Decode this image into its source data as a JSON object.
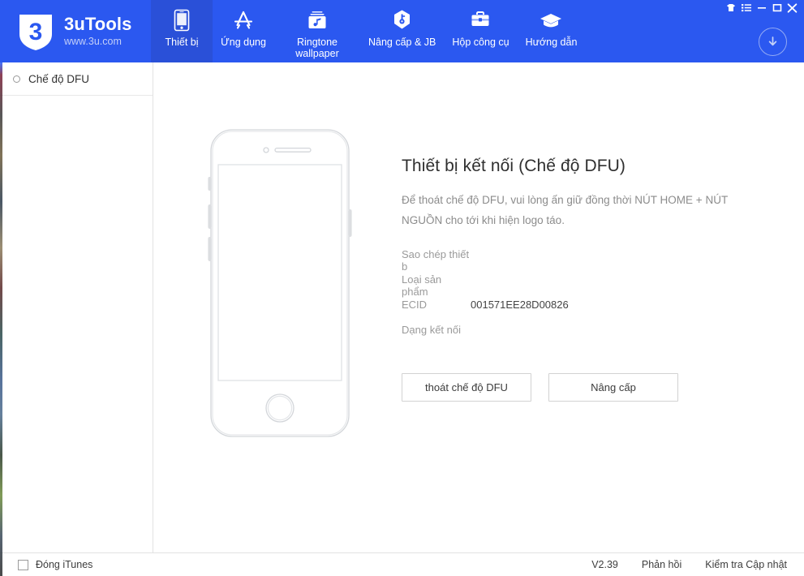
{
  "header": {
    "logo": {
      "mark": "shield-3-logo",
      "title": "3uTools",
      "subtitle": "www.3u.com"
    },
    "nav": [
      {
        "label": "Thiết bị",
        "icon": "phone-icon",
        "active": true
      },
      {
        "label": "Ứng dụng",
        "icon": "appstore-icon",
        "active": false
      },
      {
        "label": "Ringtone wallpaper",
        "icon": "ringtone-wallpaper-icon",
        "active": false
      },
      {
        "label": "Nâng cấp & JB",
        "icon": "shield-key-icon",
        "active": false
      },
      {
        "label": "Hộp công cụ",
        "icon": "toolbox-icon",
        "active": false
      },
      {
        "label": "Hướng dẫn",
        "icon": "graduation-cap-icon",
        "active": false
      }
    ],
    "window_buttons": [
      {
        "name": "skin-icon",
        "title": "Skin"
      },
      {
        "name": "menu-icon",
        "title": "Menu"
      },
      {
        "name": "minimize-icon",
        "title": "Minimize"
      },
      {
        "name": "maximize-icon",
        "title": "Maximize"
      },
      {
        "name": "close-icon",
        "title": "Close"
      }
    ],
    "download_button": {
      "name": "download-icon",
      "title": "Downloads"
    }
  },
  "sidebar": {
    "items": [
      {
        "label": "Chế độ DFU",
        "selected": true
      }
    ]
  },
  "main": {
    "device_illustration": "iphone-outline",
    "title": "Thiết bị kết nối (Chế độ DFU)",
    "description": "Để thoát chế độ DFU, vui lòng ấn giữ đồng thời NÚT HOME + NÚT NGUỒN cho tới khi hiện logo táo.",
    "rows": [
      {
        "key": "Sao chép thiết b",
        "value": ""
      },
      {
        "key": "Loại sản phẩm",
        "value": ""
      },
      {
        "key": "ECID",
        "value": "001571EE28D00826"
      },
      {
        "key": "Dạng kết nối",
        "value": ""
      }
    ],
    "buttons": [
      {
        "label": "thoát chế độ DFU"
      },
      {
        "label": "Nâng cấp"
      }
    ]
  },
  "statusbar": {
    "close_itunes_label": "Đóng iTunes",
    "close_itunes_checked": false,
    "version": "V2.39",
    "feedback_label": "Phản hồi",
    "check_update_label": "Kiểm tra Cập nhật"
  },
  "colors": {
    "brand_blue": "#2b58f0",
    "active_tab_blue": "#2a50d8",
    "logo_sub": "#c3cff8",
    "text_dark": "#2f2f2f",
    "text_muted": "#8c8c8c",
    "border": "#e2e2e2"
  }
}
